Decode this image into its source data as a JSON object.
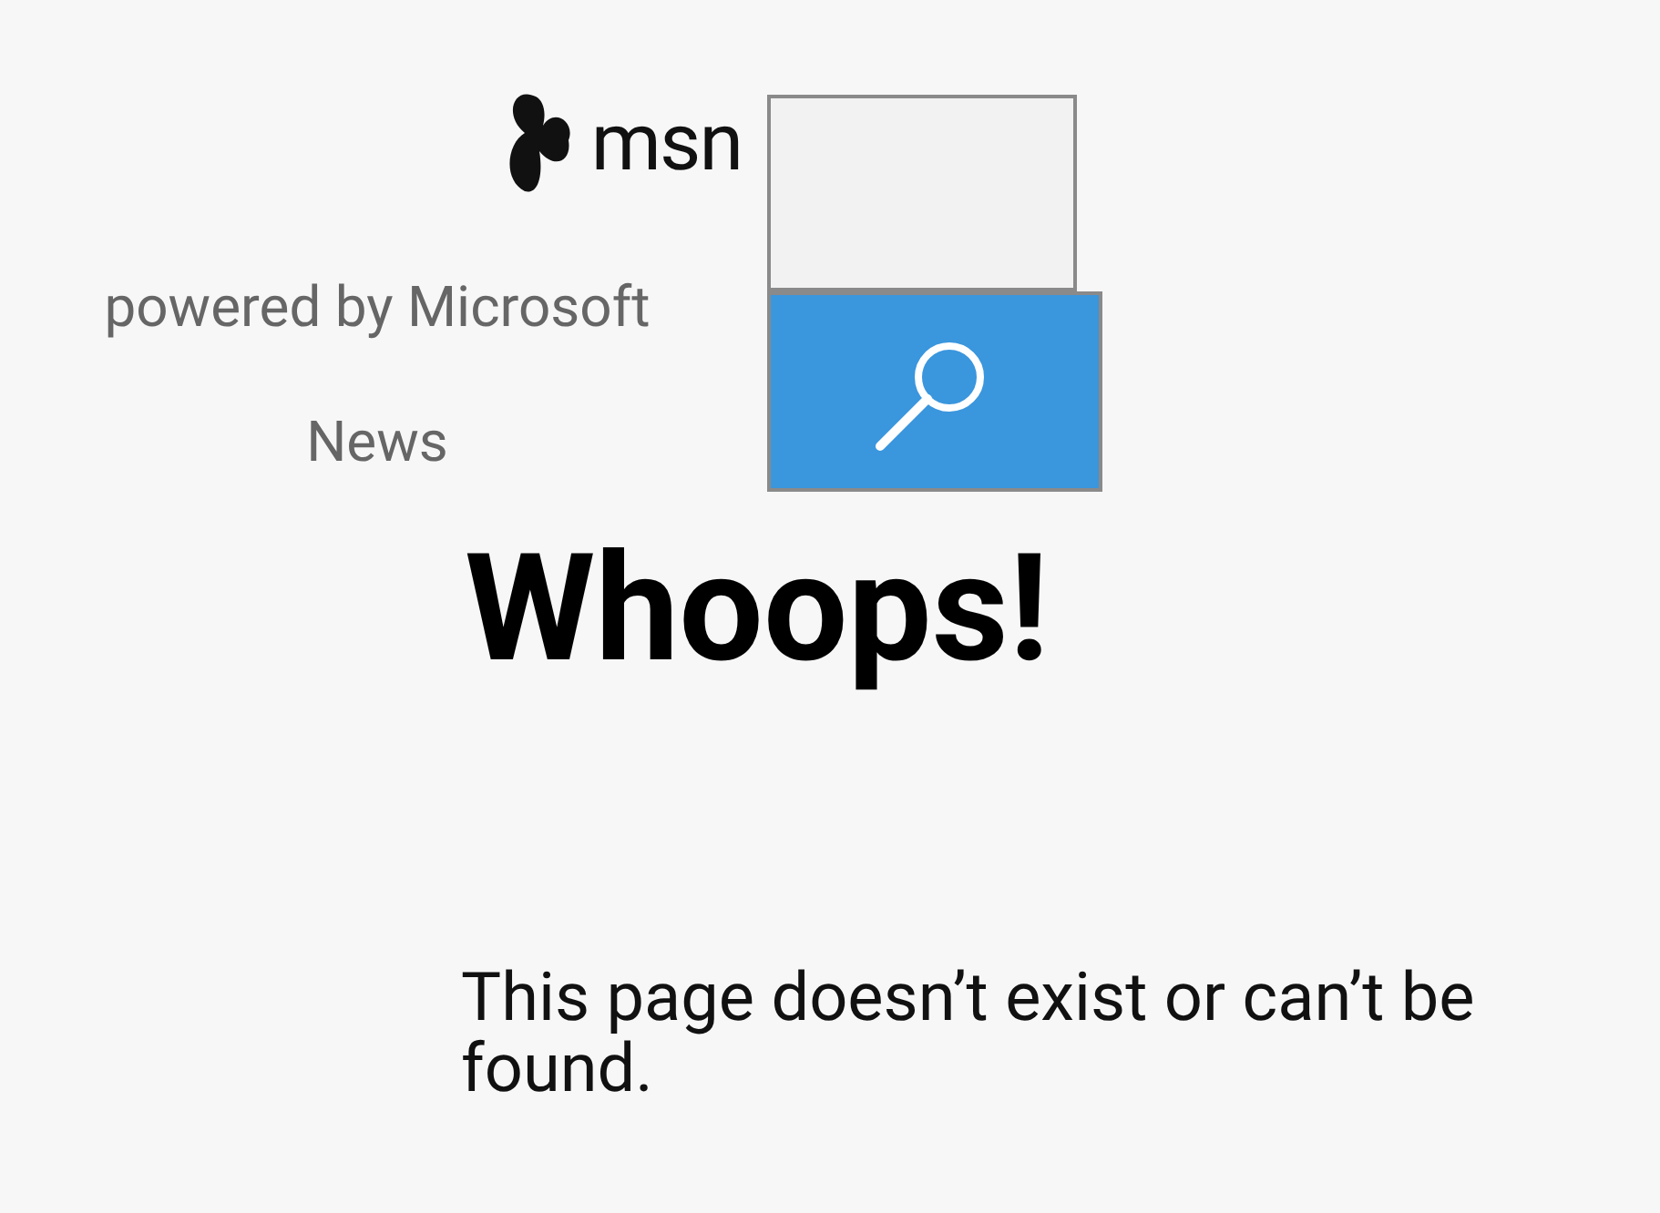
{
  "header": {
    "logo_text": "msn",
    "tagline": "powered by Microsoft",
    "section": "News"
  },
  "error": {
    "title": "Whoops!",
    "message": "This page doesn’t exist or can’t be found."
  }
}
